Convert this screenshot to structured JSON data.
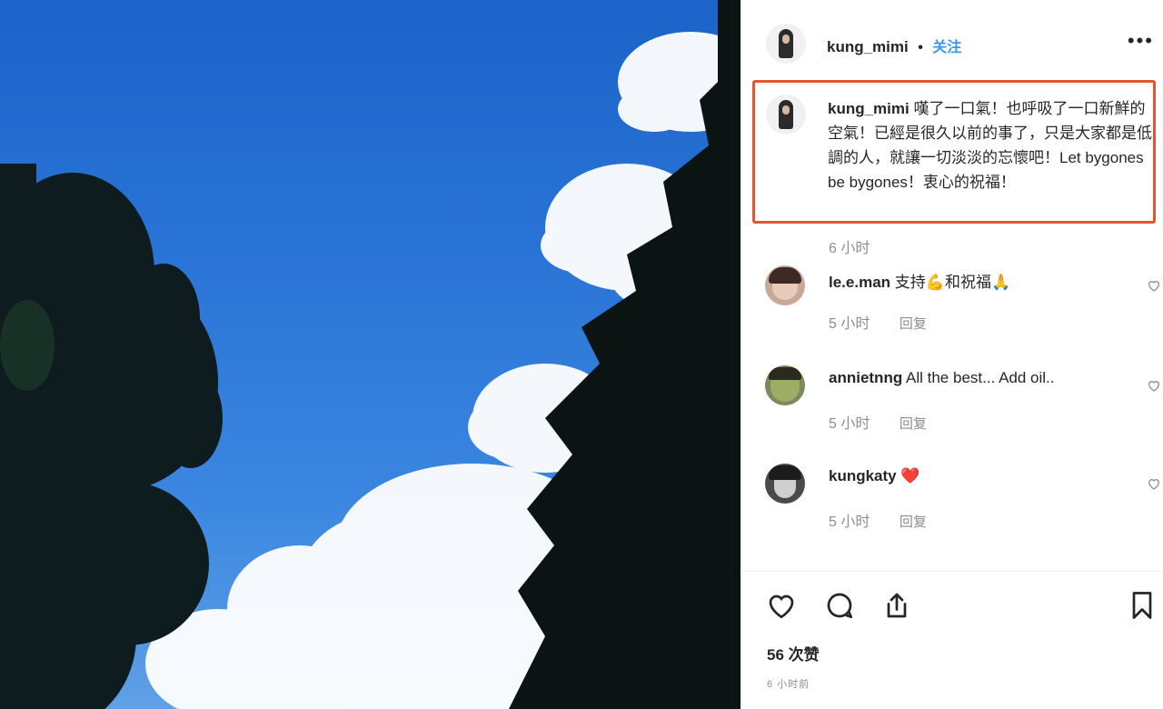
{
  "post": {
    "author": "kung_mimi",
    "follow_label": "关注",
    "separator": "•",
    "more_label": "•••",
    "caption_author": "kung_mimi",
    "caption": "嘆了一口氣！也呼吸了一口新鮮的空氣！已經是很久以前的事了，只是大家都是低調的人，就讓一切淡淡的忘懷吧！Let bygones be bygones！衷心的祝福！",
    "caption_time": "6 小时"
  },
  "comments": [
    {
      "user": "le.e.man",
      "text": "支持💪和祝福🙏",
      "time": "5 小时",
      "reply_label": "回复"
    },
    {
      "user": "annietnng",
      "text": "All the best... Add oil..",
      "time": "5 小时",
      "reply_label": "回复"
    },
    {
      "user": "kungkaty",
      "text": "❤️",
      "time": "5 小时",
      "reply_label": "回复"
    }
  ],
  "footer": {
    "likes": "56 次赞",
    "post_time": "6 小时前"
  },
  "icons": [
    "heart-icon",
    "comment-icon",
    "share-icon",
    "bookmark-icon",
    "more-icon"
  ],
  "colors": {
    "highlight_border": "#e3552e",
    "follow_blue": "#3897f0",
    "meta_gray": "#8e8e8e"
  }
}
